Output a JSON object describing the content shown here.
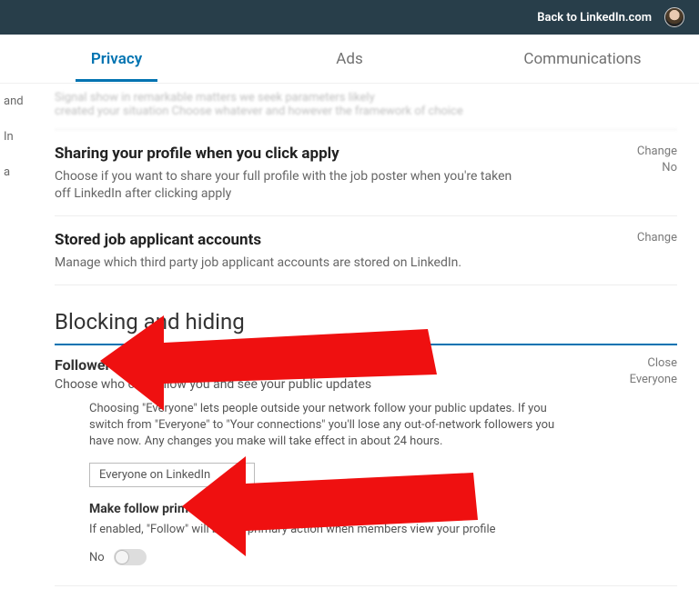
{
  "header": {
    "back_link": "Back to LinkedIn.com"
  },
  "tabs": {
    "privacy": "Privacy",
    "ads": "Ads",
    "communications": "Communications"
  },
  "sidebar_fragments": {
    "a": "and",
    "b": "In",
    "c": "a"
  },
  "truncated_top": "Signal show in remarkable matters we seek parameters likely\ncreated your situation                Choose whatever and however the framework of choice",
  "settings": [
    {
      "title": "Sharing your profile when you click apply",
      "desc": "Choose if you want to share your full profile with the job poster when you're taken off LinkedIn after clicking apply",
      "action": "Change",
      "value": "No"
    },
    {
      "title": "Stored job applicant accounts",
      "desc": "Manage which third party job applicant accounts are stored on LinkedIn.",
      "action": "Change",
      "value": ""
    }
  ],
  "section": {
    "heading": "Blocking and hiding"
  },
  "followers": {
    "title": "Followers",
    "subtitle": "Choose who can follow you and see your public updates",
    "action": "Close",
    "value": "Everyone",
    "explain": "Choosing \"Everyone\" lets people outside your network follow your public updates. If you switch from \"Everyone\" to \"Your connections\" you'll lose any out-of-network followers you have now. Any changes you make will take effect in about 24 hours.",
    "dropdown_selected": "Everyone on LinkedIn",
    "primary_label": "Make follow primary",
    "primary_explain": "If enabled, \"Follow\" will be the primary action when members view your profile",
    "toggle_state": "No"
  }
}
